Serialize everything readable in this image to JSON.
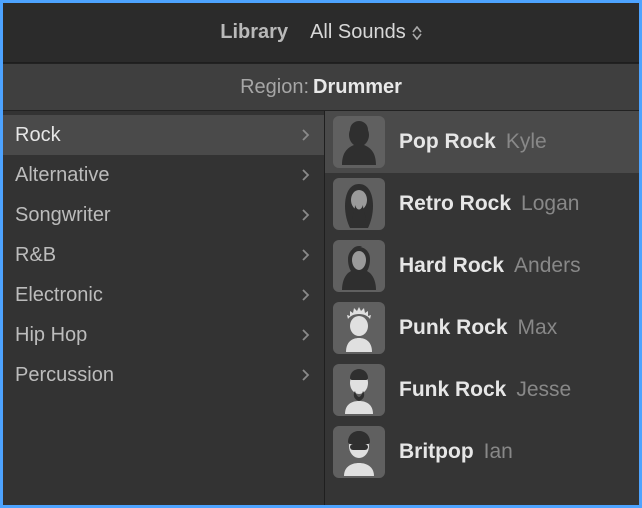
{
  "toolbar": {
    "library_tab": "Library",
    "sounds_dropdown": "All Sounds"
  },
  "region": {
    "label": "Region:",
    "value": "Drummer"
  },
  "genres": [
    {
      "label": "Rock",
      "selected": true
    },
    {
      "label": "Alternative",
      "selected": false
    },
    {
      "label": "Songwriter",
      "selected": false
    },
    {
      "label": "R&B",
      "selected": false
    },
    {
      "label": "Electronic",
      "selected": false
    },
    {
      "label": "Hip Hop",
      "selected": false
    },
    {
      "label": "Percussion",
      "selected": false
    }
  ],
  "drummers": [
    {
      "style": "Pop Rock",
      "name": "Kyle",
      "avatar": "kyle",
      "selected": true
    },
    {
      "style": "Retro Rock",
      "name": "Logan",
      "avatar": "logan",
      "selected": false
    },
    {
      "style": "Hard Rock",
      "name": "Anders",
      "avatar": "anders",
      "selected": false
    },
    {
      "style": "Punk Rock",
      "name": "Max",
      "avatar": "max",
      "selected": false
    },
    {
      "style": "Funk Rock",
      "name": "Jesse",
      "avatar": "jesse",
      "selected": false
    },
    {
      "style": "Britpop",
      "name": "Ian",
      "avatar": "ian",
      "selected": false
    }
  ]
}
